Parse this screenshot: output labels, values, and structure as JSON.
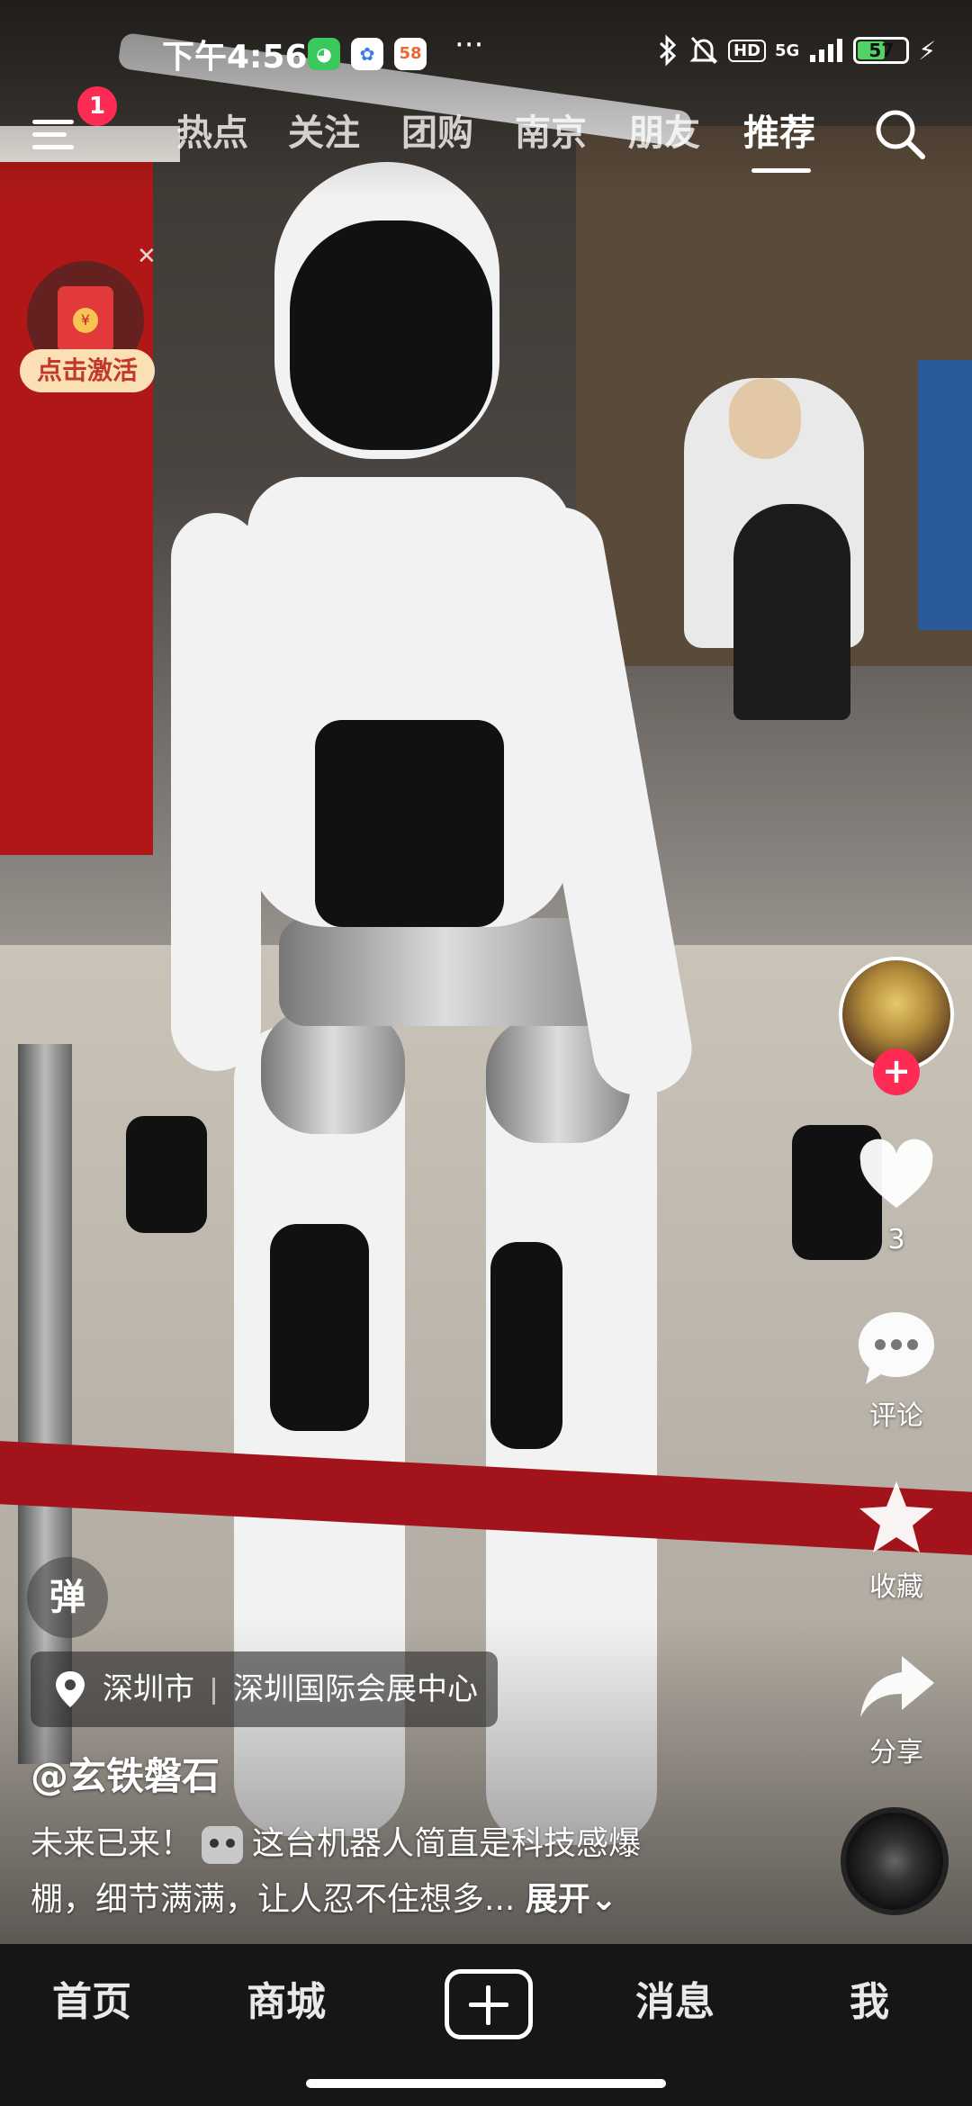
{
  "status_bar": {
    "time": "下午4:56",
    "more": "···",
    "net": "5G",
    "hd": "HD",
    "battery_percent": "57",
    "app_icons": [
      "cat-app-icon",
      "clover-app-icon",
      "58-app-icon"
    ]
  },
  "top_nav": {
    "notification_count": "1",
    "tabs": [
      "热点",
      "关注",
      "团购",
      "南京",
      "朋友",
      "推荐"
    ],
    "active_tab": "推荐"
  },
  "red_packet": {
    "label": "点击激活",
    "seal": "¥"
  },
  "rail": {
    "like_count": "3",
    "comment_label": "评论",
    "collect_label": "收藏",
    "share_label": "分享"
  },
  "post": {
    "danmaku": "弹",
    "location_city": "深圳市",
    "location_place": "深圳国际会展中心",
    "author": "@玄铁磐石",
    "caption_line1_a": "未来已来！",
    "caption_line1_b": "这台机器人简直是科技感爆",
    "caption_line2": "棚，细节满满，让人忍不住想多...",
    "expand_label": "展开"
  },
  "bottom_nav": {
    "home": "首页",
    "mall": "商城",
    "messages": "消息",
    "me": "我"
  },
  "colors": {
    "accent": "#fe2c55",
    "nav_bg": "#161616",
    "battery": "#52d36a"
  }
}
